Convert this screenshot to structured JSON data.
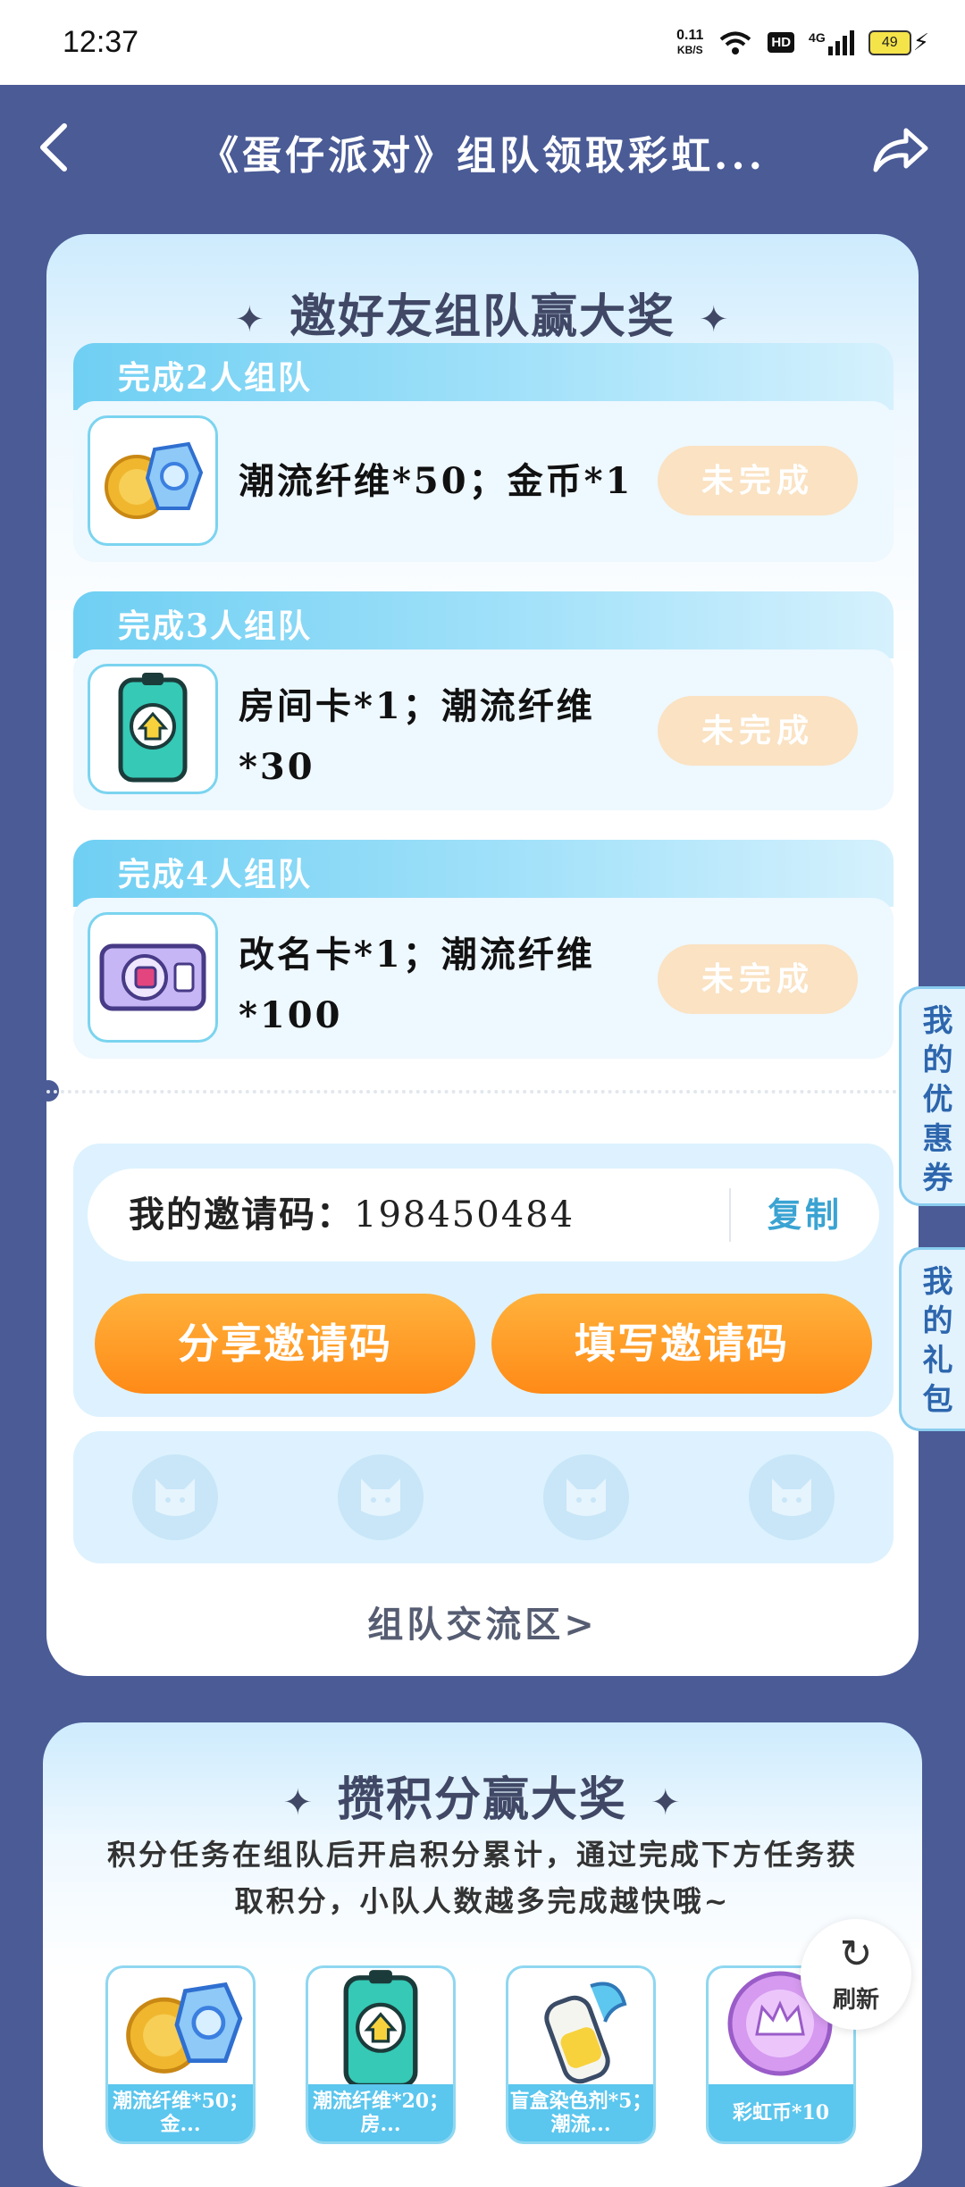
{
  "status_bar": {
    "time": "12:37",
    "net_speed_value": "0.11",
    "net_speed_unit": "KB/S",
    "hd_label": "HD",
    "signal_label": "4G",
    "battery": "49"
  },
  "header": {
    "title": "《蛋仔派对》组队领取彩虹..."
  },
  "team_section": {
    "title": "邀好友组队赢大奖",
    "tasks": [
      {
        "band": "完成2人组队",
        "reward": "潮流纤维*50；金币*1",
        "button": "未完成"
      },
      {
        "band": "完成3人组队",
        "reward": "房间卡*1；潮流纤维*30",
        "button": "未完成"
      },
      {
        "band": "完成4人组队",
        "reward": "改名卡*1；潮流纤维*100",
        "button": "未完成"
      }
    ],
    "invite_label": "我的邀请码：",
    "invite_code": "198450484",
    "copy_label": "复制",
    "share_button": "分享邀请码",
    "fill_button": "填写邀请码",
    "team_link": "组队交流区>"
  },
  "side_tabs": {
    "coupons": "我的优惠券",
    "gifts": "我的礼包"
  },
  "points_section": {
    "title": "攒积分赢大奖",
    "description": "积分任务在组队后开启积分累计，通过完成下方任务获取积分，小队人数越多完成越快哦~",
    "rewards": [
      {
        "caption": "潮流纤维*50；金..."
      },
      {
        "caption": "潮流纤维*20；房..."
      },
      {
        "caption": "盲盒染色剂*5；潮流..."
      },
      {
        "caption": "彩虹币*10"
      }
    ]
  },
  "refresh": {
    "label": "刷新"
  },
  "colors": {
    "page_bg": "#4a5b96",
    "accent_orange": "#ff8a17",
    "accent_blue": "#3aa3d2",
    "pending_button": "#fae2c2"
  }
}
